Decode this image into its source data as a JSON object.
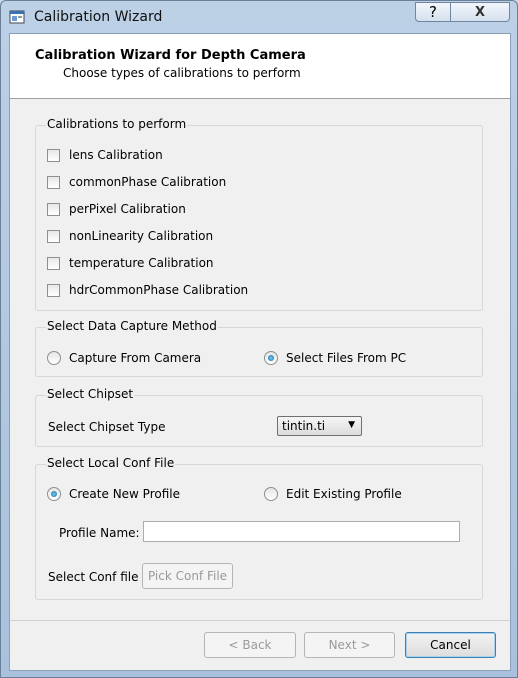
{
  "window": {
    "title": "Calibration Wizard",
    "help_glyph": "?",
    "close_glyph": "X"
  },
  "header": {
    "title": "Calibration Wizard for Depth Camera",
    "subtitle": "Choose types of calibrations to perform"
  },
  "calibrations": {
    "title": "Calibrations to perform",
    "items": [
      {
        "label": "lens Calibration",
        "checked": false
      },
      {
        "label": "commonPhase Calibration",
        "checked": false
      },
      {
        "label": "perPixel Calibration",
        "checked": false
      },
      {
        "label": "nonLinearity Calibration",
        "checked": false
      },
      {
        "label": "temperature Calibration",
        "checked": false
      },
      {
        "label": "hdrCommonPhase Calibration",
        "checked": false
      }
    ]
  },
  "capture": {
    "title": "Select Data Capture Method",
    "option_camera": "Capture From Camera",
    "option_files": "Select Files From PC",
    "selected": "files"
  },
  "chipset": {
    "title": "Select Chipset",
    "label": "Select Chipset Type",
    "value": "tintin.ti"
  },
  "conf": {
    "title": "Select Local Conf File",
    "option_new": "Create New Profile",
    "option_existing": "Edit Existing Profile",
    "selected": "new",
    "profile_label": "Profile Name:",
    "profile_value": "",
    "pick_label": "Select Conf file",
    "pick_button": "Pick Conf File"
  },
  "footer": {
    "back": "< Back",
    "next": "Next >",
    "cancel": "Cancel"
  }
}
